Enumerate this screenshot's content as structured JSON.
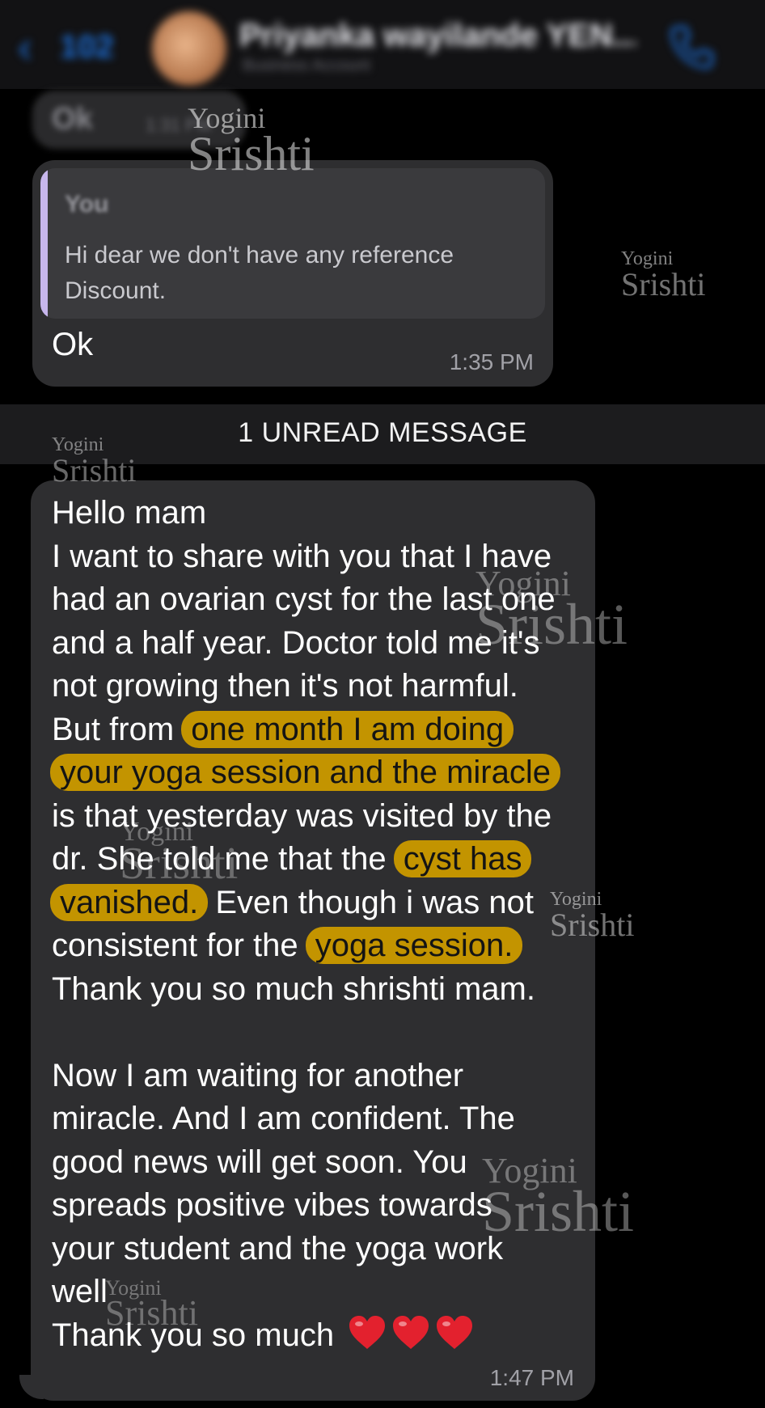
{
  "header": {
    "back_count": "102",
    "contact_name": "Priyanka wayilande YEN...",
    "contact_subtitle": "Business Account",
    "icons": {
      "back": "chevron-left-icon",
      "call": "phone-icon"
    }
  },
  "messages": {
    "blurred_bubble": {
      "text": "Ok",
      "time": "1:31 PM"
    },
    "reply": {
      "quote_author": "You",
      "quote_text": "Hi dear we don't have any reference Discount.",
      "text": "Ok",
      "time": "1:35 PM"
    },
    "divider": {
      "text": "1 UNREAD MESSAGE"
    },
    "main": {
      "lines": [
        {
          "a": "Hello mam"
        },
        {
          "a": "I want to share with you that I have"
        },
        {
          "a": "had an ovarian cyst for the last one"
        },
        {
          "a": "and a half year. Doctor told me it's"
        },
        {
          "a": "not growing then it's not harmful."
        },
        {
          "a": "But from ",
          "hl": "one month I am doing"
        },
        {
          "hl": "your yoga session and the miracle"
        },
        {
          "a": "is that yesterday was visited by the"
        },
        {
          "a": "dr. She told me that the ",
          "hl": "cyst has"
        },
        {
          "hl": "vanished.",
          "b": " Even though i was not"
        },
        {
          "a": "consistent for the ",
          "hl": "yoga session."
        },
        {
          "a": "Thank you so much shrishti mam."
        },
        {
          "a": ""
        },
        {
          "a": "Now I am waiting for another"
        },
        {
          "a": "miracle. And I am confident. The"
        },
        {
          "a": "good news will get soon. You"
        },
        {
          "a": "spreads positive vibes towards"
        },
        {
          "a": "your student and the yoga work"
        },
        {
          "a": "well"
        },
        {
          "a": "Thank you so much "
        }
      ],
      "emoji_count": 3,
      "time": "1:47 PM"
    }
  },
  "watermark": {
    "top": "Yogini",
    "bottom": "Srishti"
  },
  "colors": {
    "background": "#000000",
    "bubble": "#2e2e30",
    "highlight": "#c39400",
    "quote_bar": "#c7b6ec",
    "link_blue": "#1d6fd8",
    "heart": "#e3212e"
  }
}
